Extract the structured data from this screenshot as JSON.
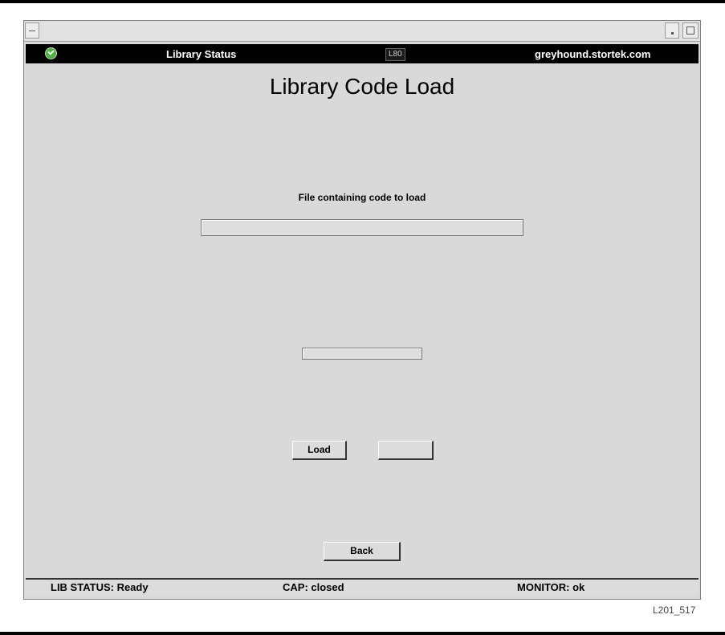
{
  "window": {
    "status_bar": {
      "title": "Library Status",
      "model": "L80",
      "hostname": "greyhound.stortek.com",
      "status_icon": "ok-check-icon",
      "status_icon_color": "#47b53a"
    },
    "main": {
      "page_title": "Library Code Load",
      "file_label": "File containing code to load",
      "file_input_value": "",
      "progress_value": "",
      "load_button": "Load",
      "blank_button": "",
      "back_button": "Back"
    },
    "footer": {
      "lib_status": "LIB STATUS: Ready",
      "cap": "CAP: closed",
      "monitor": "MONITOR: ok"
    }
  },
  "figure_id": "L201_517"
}
